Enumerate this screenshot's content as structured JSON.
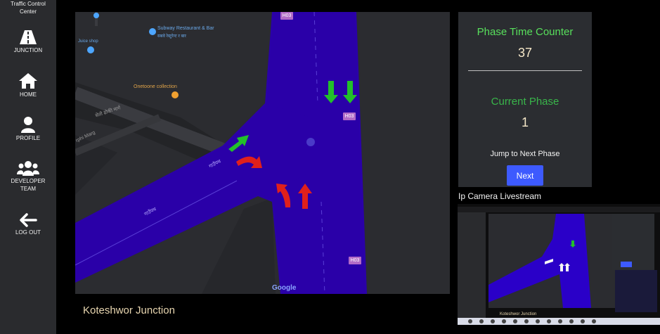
{
  "sidebar": {
    "brand": "Traffic Control Center",
    "items": [
      {
        "label": "JUNCTION",
        "icon": "road-icon"
      },
      {
        "label": "HOME",
        "icon": "home-icon"
      },
      {
        "label": "PROFILE",
        "icon": "user-icon"
      },
      {
        "label": "DEVELOPER TEAM",
        "icon": "team-icon"
      },
      {
        "label": "LOG OUT",
        "icon": "arrow-left-icon"
      }
    ]
  },
  "map": {
    "labels": {
      "restaurant": "Subway Restaurant & Bar",
      "restaurant_sub": "सबवे रेस्टुरेन्ट र बार",
      "collection": "Onetoone collection",
      "juice": "Juice shop",
      "street1": "सेतो ढोकी मार्ग",
      "street2": "rphi Marg",
      "road1": "गाउँपथ",
      "road2": "गाउँपथ"
    },
    "route_badge": "H03",
    "attribution": "Google"
  },
  "junction_title": "Koteshwor Junction",
  "panel": {
    "phase_time_label": "Phase Time Counter",
    "phase_time_value": "37",
    "current_phase_label": "Current Phase",
    "current_phase_value": "1",
    "jump_label": "Jump to Next Phase",
    "next_button": "Next"
  },
  "camera": {
    "title": "Ip Camera Livestream"
  },
  "colors": {
    "road": "#2a00a8",
    "green_arrow": "#22c02a",
    "red_arrow": "#e0201c",
    "accent_blue": "#3d5afe",
    "panel_green": "#58e05c"
  }
}
